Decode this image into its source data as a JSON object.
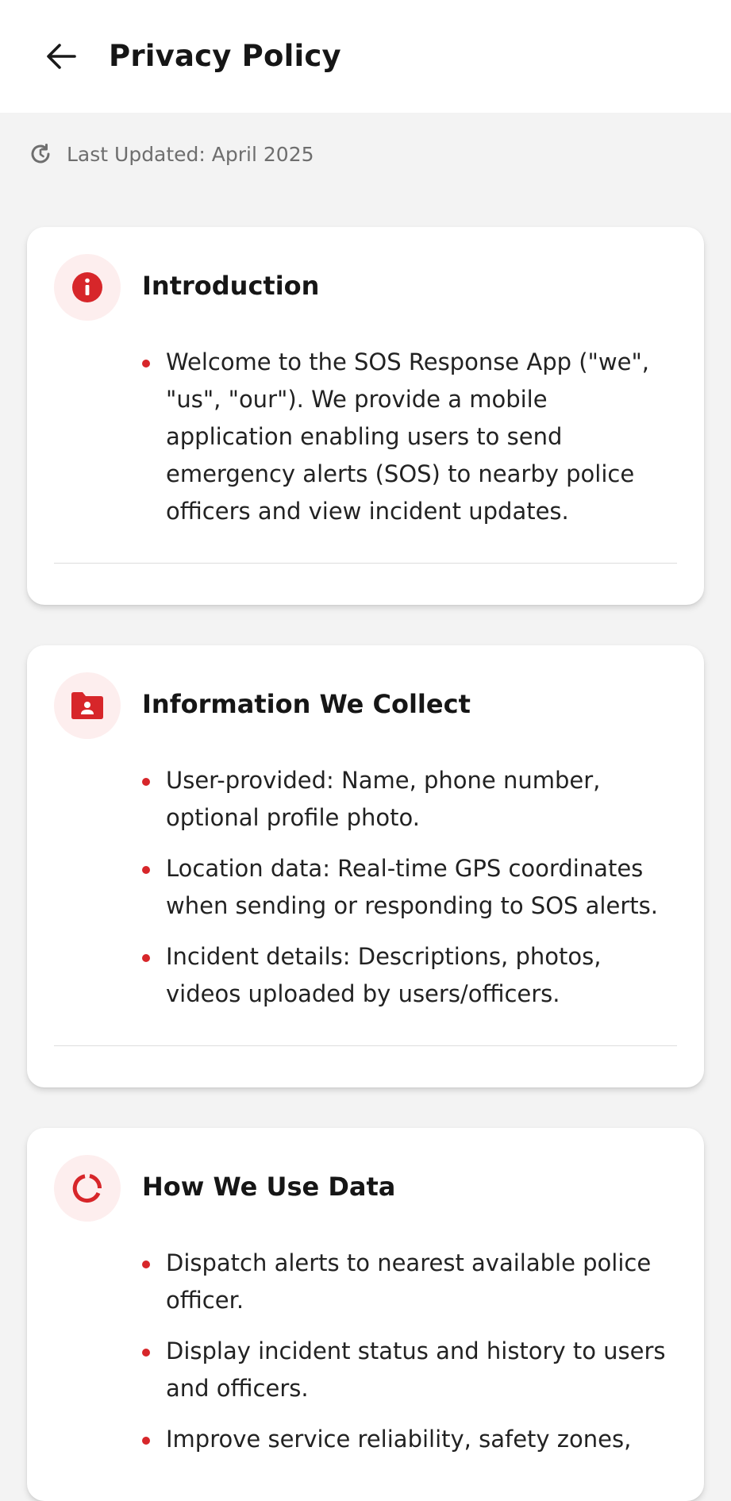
{
  "header": {
    "title": "Privacy Policy"
  },
  "meta": {
    "last_updated": "Last Updated: April 2025"
  },
  "colors": {
    "accent": "#d7262a",
    "icon_bg": "#fdeeee",
    "page_bg": "#f3f3f3"
  },
  "sections": [
    {
      "icon": "info-icon",
      "title": "Introduction",
      "bullets": [
        "Welcome to the SOS Response App (\"we\", \"us\", \"our\"). We provide a mobile application enabling users to send emergency alerts (SOS) to nearby police officers and view incident updates."
      ]
    },
    {
      "icon": "folder-user-icon",
      "title": "Information We Collect",
      "bullets": [
        "User-provided: Name, phone number, optional profile photo.",
        "Location data: Real-time GPS coordinates when sending or responding to SOS alerts.",
        "Incident details: Descriptions, photos, videos uploaded by users/officers."
      ]
    },
    {
      "icon": "data-usage-icon",
      "title": "How We Use Data",
      "bullets": [
        "Dispatch alerts to nearest available police officer.",
        "Display incident status and history to users and officers.",
        "Improve service reliability, safety zones,"
      ]
    }
  ]
}
